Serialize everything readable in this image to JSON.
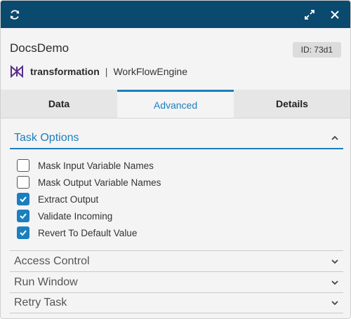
{
  "titlebar": {
    "refresh_icon": "refresh-icon",
    "expand_icon": "expand-arrows-icon",
    "close_icon": "close-icon"
  },
  "header": {
    "app_name": "DocsDemo",
    "id_badge": "ID: 73d1",
    "brand": "transformation",
    "separator": "|",
    "engine": "WorkFlowEngine"
  },
  "tabs": [
    {
      "label": "Data",
      "active": false
    },
    {
      "label": "Advanced",
      "active": true
    },
    {
      "label": "Details",
      "active": false
    }
  ],
  "task_options": {
    "title": "Task Options",
    "expanded": true,
    "options": [
      {
        "label": "Mask Input Variable Names",
        "checked": false
      },
      {
        "label": "Mask Output Variable Names",
        "checked": false
      },
      {
        "label": "Extract Output",
        "checked": true
      },
      {
        "label": "Validate Incoming",
        "checked": true
      },
      {
        "label": "Revert To Default Value",
        "checked": true
      }
    ]
  },
  "collapsed_sections": [
    {
      "title": "Access Control"
    },
    {
      "title": "Run Window"
    },
    {
      "title": "Retry Task"
    }
  ],
  "colors": {
    "titlebar": "#0b4a6f",
    "accent": "#1a7fbf",
    "logo": "#5b2d8e"
  }
}
